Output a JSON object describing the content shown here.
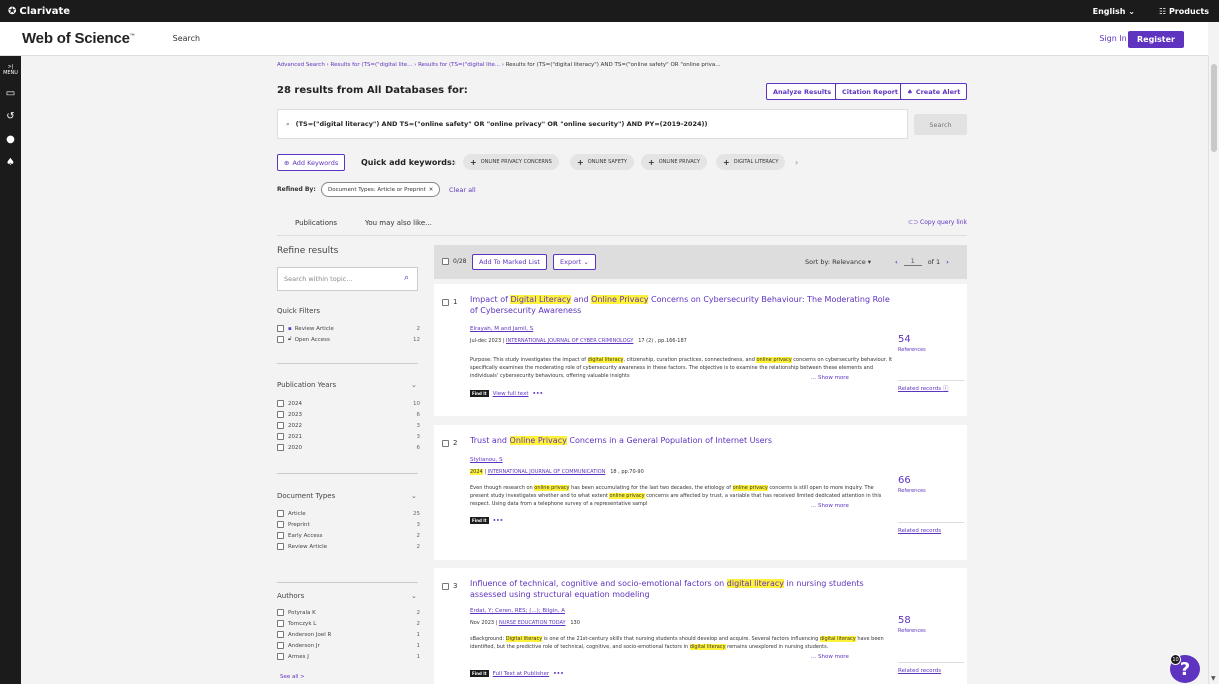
{
  "topbar": {
    "brand": "Clarivate",
    "language": "English",
    "products": "Products"
  },
  "header": {
    "logo": "Web of Science",
    "logo_mark": "™",
    "nav_search": "Search",
    "sign_in": "Sign In",
    "register": "Register"
  },
  "leftbar": {
    "menu_label": "MENU"
  },
  "breadcrumb": {
    "items": [
      "Advanced Search",
      "Results for (TS=(\"digital lite...",
      "Results for (TS=(\"digital lite..."
    ],
    "current": "Results for (TS=(\"digital literacy\") AND TS=(\"online safety\" OR \"online priva..."
  },
  "results": {
    "title": "28 results from All Databases for:",
    "analyze": "Analyze Results",
    "citation": "Citation Report",
    "alert": "Create Alert"
  },
  "query": {
    "text": "(TS=(\"digital literacy\") AND TS=(\"online safety\" OR \"online privacy\" OR \"online security\") AND PY=(2019-2024))",
    "search_button": "Search"
  },
  "keywords": {
    "add_button": "Add Keywords",
    "quick_label": "Quick add keywords:",
    "chips": [
      "ONLINE PRIVACY CONCERNS",
      "ONLINE SAFETY",
      "ONLINE PRIVACY",
      "DIGITAL LITERACY"
    ]
  },
  "refined": {
    "label": "Refined By:",
    "chip": "Document Types: Article or Preprint",
    "clear": "Clear all"
  },
  "tabs": {
    "publications": "Publications",
    "also_like": "You may also like...",
    "copy_link": "Copy query link"
  },
  "refine": {
    "title": "Refine results",
    "search_placeholder": "Search within topic...",
    "quick_filters": {
      "title": "Quick Filters",
      "items": [
        {
          "label": "Review Article",
          "count": "2"
        },
        {
          "label": "Open Access",
          "count": "12"
        }
      ]
    },
    "years": {
      "title": "Publication Years",
      "items": [
        {
          "label": "2024",
          "count": "10"
        },
        {
          "label": "2023",
          "count": "6"
        },
        {
          "label": "2022",
          "count": "3"
        },
        {
          "label": "2021",
          "count": "3"
        },
        {
          "label": "2020",
          "count": "6"
        }
      ]
    },
    "doctypes": {
      "title": "Document Types",
      "items": [
        {
          "label": "Article",
          "count": "25"
        },
        {
          "label": "Preprint",
          "count": "3"
        },
        {
          "label": "Early Access",
          "count": "2"
        },
        {
          "label": "Review Article",
          "count": "2"
        }
      ]
    },
    "authors": {
      "title": "Authors",
      "items": [
        {
          "label": "Potyrala K",
          "count": "2"
        },
        {
          "label": "Tomczyk L",
          "count": "2"
        },
        {
          "label": "Anderson Joel R",
          "count": "1"
        },
        {
          "label": "Anderson Jr",
          "count": "1"
        },
        {
          "label": "Armes J",
          "count": "1"
        }
      ],
      "see_all": "See all >"
    }
  },
  "resultbar": {
    "count": "0/28",
    "marked": "Add To Marked List",
    "export": "Export",
    "sort": "Sort by: Relevance",
    "page": "1",
    "of": "of 1"
  },
  "records": [
    {
      "num": "1",
      "title_parts": [
        "Impact of ",
        "Digital Literacy",
        " and ",
        "Online Privacy",
        " Concerns on Cybersecurity Behaviour: The Moderating Role of Cybersecurity Awareness"
      ],
      "authors": "Elrayah, M and Jamil, S",
      "date": "Jul-dec 2023 | ",
      "journal": "INTERNATIONAL JOURNAL OF CYBER CRIMINOLOGY",
      "vol": "17 (2) , pp.166-187",
      "abstract_parts": [
        "Purpose: This study investigates the impact of ",
        "digital literacy",
        ", citizenship, curation practices, connectedness, and ",
        "online privacy",
        " concerns on cybersecurity behaviour. It specifically examines the moderating role of cybersecurity awareness in these factors. The objective is to examine the relationship between these elements and individuals' cybersecurity behaviours, offering valuable insights"
      ],
      "link": "View full text",
      "refs": "54",
      "refs_label": "References",
      "related": "Related records"
    },
    {
      "num": "2",
      "title_parts": [
        "Trust and ",
        "Online Privacy",
        " Concerns in a General Population of Internet Users",
        "",
        ""
      ],
      "authors": "Stylianou, S",
      "date": "2024",
      "journal": "INTERNATIONAL JOURNAL OF COMMUNICATION",
      "vol": "18 , pp.70-90",
      "abstract_parts": [
        "Even though research on ",
        "online privacy",
        " has been accumulating for the last two decades, the etiology of ",
        "online privacy",
        " concerns is still open to more inquiry. The present study investigates whether and to what extent ",
        "online privacy",
        " concerns are affected by trust, a variable that has received limited dedicated attention in this respect. Using data from a telephone survey of a representative sampl"
      ],
      "refs": "66",
      "refs_label": "References",
      "related": "Related records"
    },
    {
      "num": "3",
      "title_parts": [
        "Influence of technical, cognitive and socio-emotional factors on ",
        "digital literacy",
        " in nursing students assessed using structural equation modeling"
      ],
      "authors": "Erdat, Y; Ceren, RES; (...); Bilgin, A",
      "date": "Nov 2023 | ",
      "journal": "NURSE EDUCATION TODAY",
      "vol": "130",
      "abstract_parts": [
        "sBackground: ",
        "Digital literacy",
        " is one of the 21st-century skills that nursing students should develop and acquire. Several factors influencing ",
        "digital literacy",
        " have been identified, but the predictive role of technical, cognitive, and socio-emotional factors in ",
        "digital literacy",
        " remains unexplored in nursing students."
      ],
      "link": "Full Text at Publisher",
      "refs": "58",
      "refs_label": "References",
      "related": "Related records"
    }
  ],
  "common": {
    "show_more": "... Show more",
    "fulltext_badge": "Find It",
    "dots": "•••",
    "help_badge": "10",
    "help": "?"
  }
}
